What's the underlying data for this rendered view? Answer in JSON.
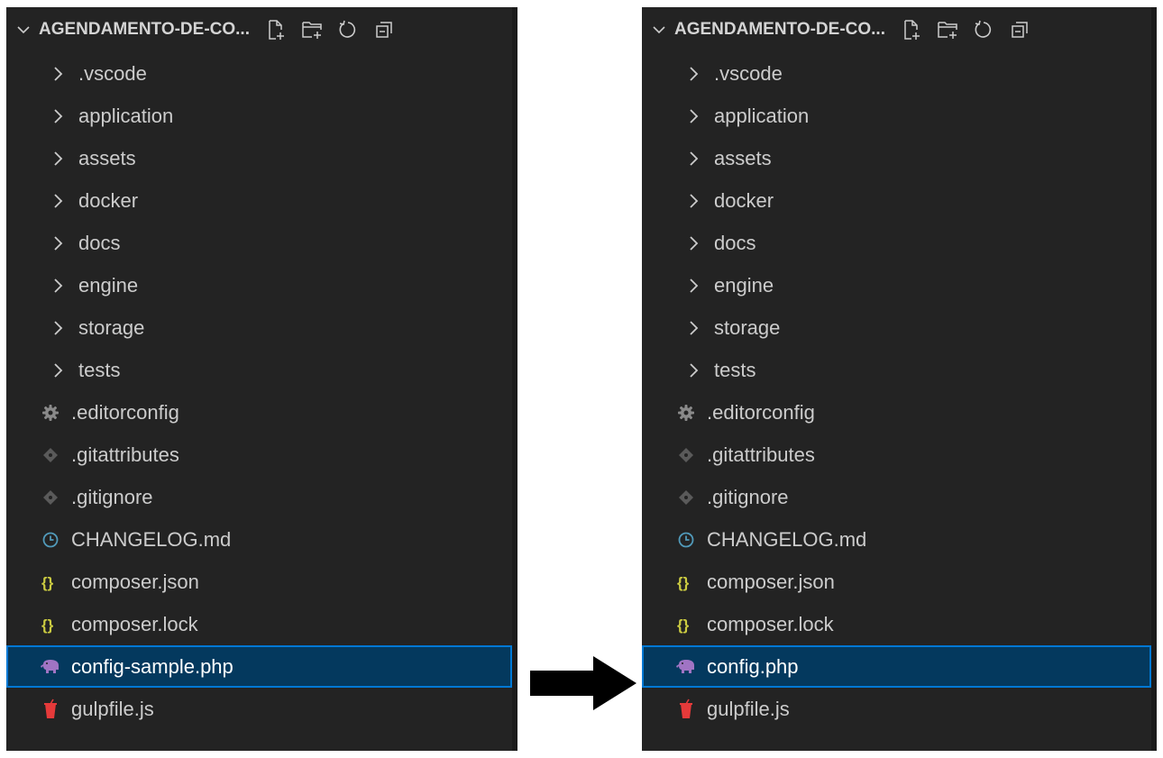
{
  "panels": [
    {
      "project_title": "AGENDAMENTO-DE-CO...",
      "actions": [
        "new-file-icon",
        "new-folder-icon",
        "refresh-icon",
        "collapse-all-icon"
      ],
      "items": [
        {
          "type": "folder",
          "label": ".vscode"
        },
        {
          "type": "folder",
          "label": "application"
        },
        {
          "type": "folder",
          "label": "assets"
        },
        {
          "type": "folder",
          "label": "docker"
        },
        {
          "type": "folder",
          "label": "docs"
        },
        {
          "type": "folder",
          "label": "engine"
        },
        {
          "type": "folder",
          "label": "storage"
        },
        {
          "type": "folder",
          "label": "tests"
        },
        {
          "type": "file",
          "label": ".editorconfig",
          "icon": "gear-icon"
        },
        {
          "type": "file",
          "label": ".gitattributes",
          "icon": "git-icon"
        },
        {
          "type": "file",
          "label": ".gitignore",
          "icon": "git-icon"
        },
        {
          "type": "file",
          "label": "CHANGELOG.md",
          "icon": "clock-icon"
        },
        {
          "type": "file",
          "label": "composer.json",
          "icon": "braces-icon"
        },
        {
          "type": "file",
          "label": "composer.lock",
          "icon": "braces-icon"
        },
        {
          "type": "file",
          "label": "config-sample.php",
          "icon": "php-elephant-icon",
          "selected": true
        },
        {
          "type": "file",
          "label": "gulpfile.js",
          "icon": "gulp-icon"
        }
      ]
    },
    {
      "project_title": "AGENDAMENTO-DE-CO...",
      "actions": [
        "new-file-icon",
        "new-folder-icon",
        "refresh-icon",
        "collapse-all-icon"
      ],
      "items": [
        {
          "type": "folder",
          "label": ".vscode"
        },
        {
          "type": "folder",
          "label": "application"
        },
        {
          "type": "folder",
          "label": "assets"
        },
        {
          "type": "folder",
          "label": "docker"
        },
        {
          "type": "folder",
          "label": "docs"
        },
        {
          "type": "folder",
          "label": "engine"
        },
        {
          "type": "folder",
          "label": "storage"
        },
        {
          "type": "folder",
          "label": "tests"
        },
        {
          "type": "file",
          "label": ".editorconfig",
          "icon": "gear-icon"
        },
        {
          "type": "file",
          "label": ".gitattributes",
          "icon": "git-icon"
        },
        {
          "type": "file",
          "label": ".gitignore",
          "icon": "git-icon"
        },
        {
          "type": "file",
          "label": "CHANGELOG.md",
          "icon": "clock-icon"
        },
        {
          "type": "file",
          "label": "composer.json",
          "icon": "braces-icon"
        },
        {
          "type": "file",
          "label": "composer.lock",
          "icon": "braces-icon"
        },
        {
          "type": "file",
          "label": "config.php",
          "icon": "php-elephant-icon",
          "selected": true
        },
        {
          "type": "file",
          "label": "gulpfile.js",
          "icon": "gulp-icon"
        }
      ]
    }
  ],
  "colors": {
    "panel_bg": "#232323",
    "text": "#cccccc",
    "selection_bg": "#04395e",
    "selection_border": "#0078d4",
    "php_purple": "#a074c4",
    "json_yellow": "#cbcb41",
    "gulp_red": "#e53a3a",
    "icon_gray": "#8a8a8a"
  },
  "arrow_icon": "right-arrow-icon"
}
